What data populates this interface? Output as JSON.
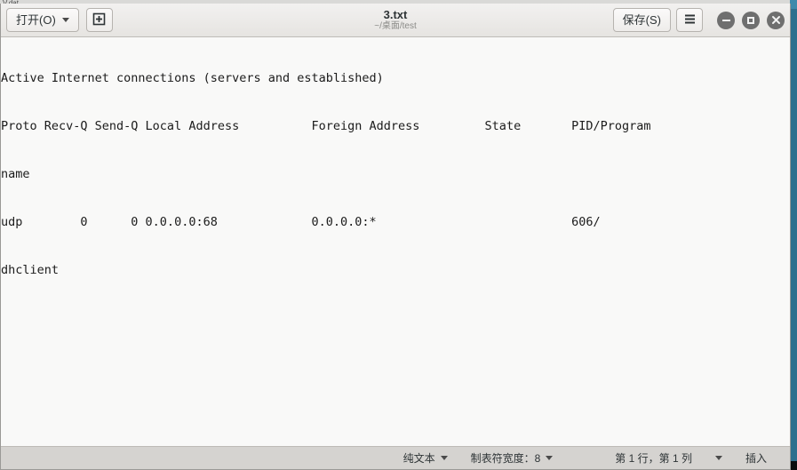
{
  "background": {
    "other_window_title": "V.dat"
  },
  "window": {
    "title": "3.txt",
    "subtitle": "~/桌面/test"
  },
  "headerbar": {
    "open_button": "打开(O)",
    "open_caret_icon": "chevron-down-icon",
    "new_document_icon": "new-document-icon",
    "save_button": "保存(S)",
    "menu_icon": "hamburger-menu-icon",
    "minimize_icon": "minimize-icon",
    "maximize_icon": "maximize-icon",
    "close_icon": "close-icon"
  },
  "editor": {
    "lines": [
      "Active Internet connections (servers and established)",
      "Proto Recv-Q Send-Q Local Address          Foreign Address         State       PID/Program",
      "name",
      "udp        0      0 0.0.0.0:68             0.0.0.0:*                           606/",
      "dhclient"
    ]
  },
  "statusbar": {
    "language": "纯文本",
    "language_caret_icon": "chevron-down-icon",
    "tab_width": "制表符宽度：8",
    "tab_width_caret_icon": "chevron-down-icon",
    "cursor_position": "第 1 行，第 1 列",
    "cursor_caret_icon": "chevron-down-icon",
    "insert_mode": "插入"
  },
  "colors": {
    "header_bg": "#ece9e6",
    "textview_bg": "#f9f9f8",
    "statusbar_bg": "#d5d3d0",
    "accent_blue": "#2e6f8e",
    "text": "#2e3436"
  }
}
